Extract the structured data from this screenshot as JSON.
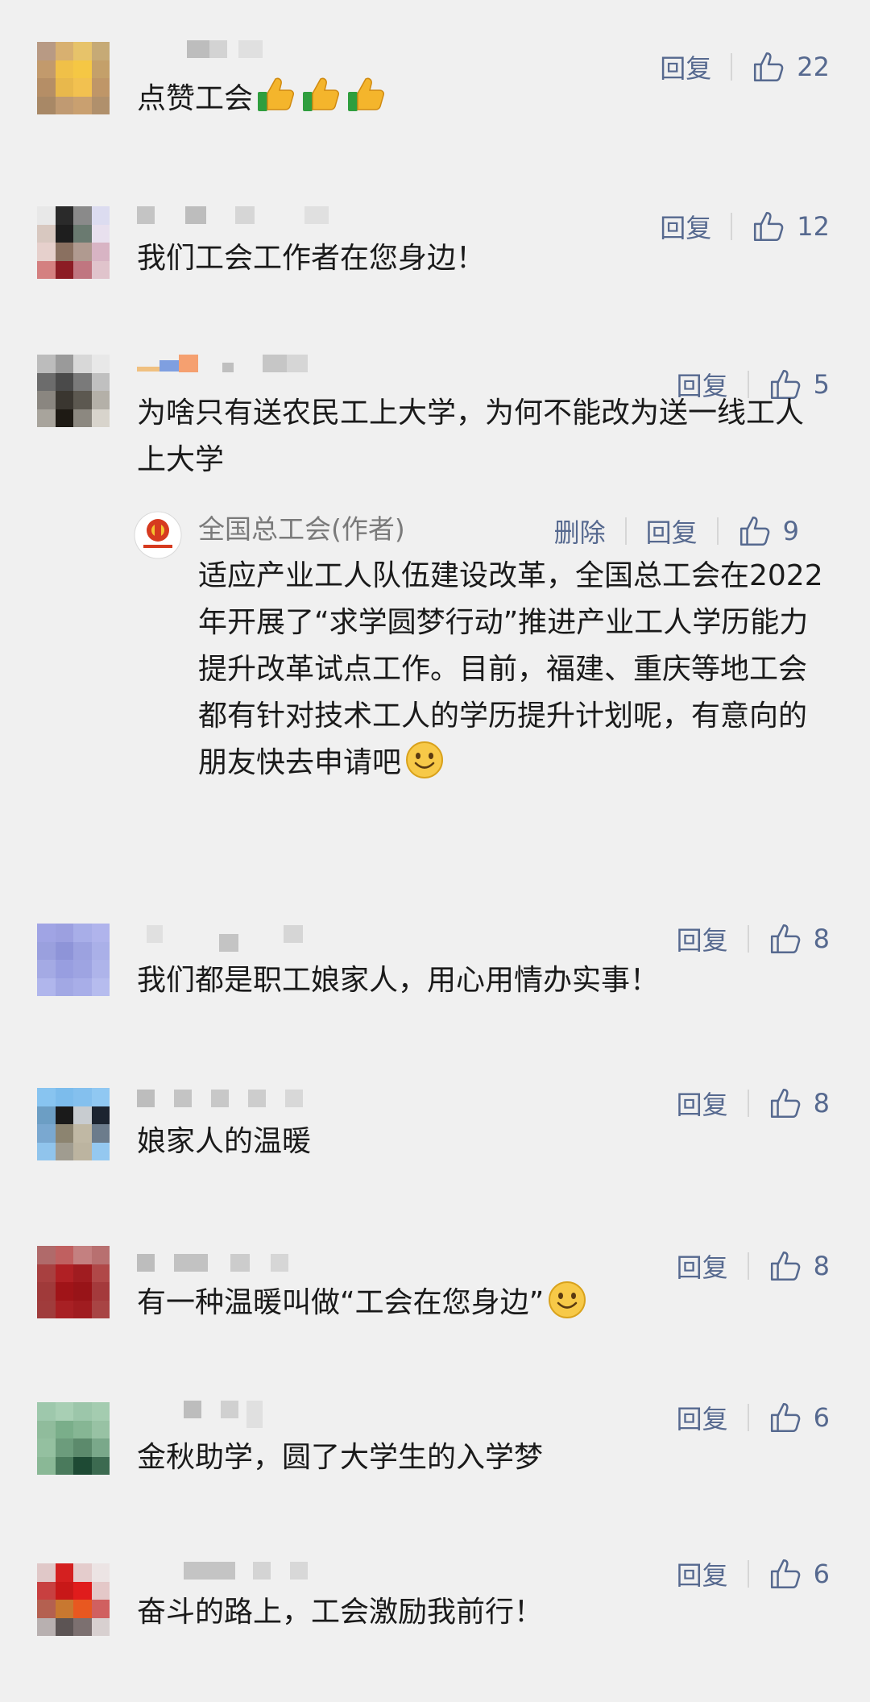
{
  "labels": {
    "reply": "回复",
    "delete": "删除"
  },
  "colors": {
    "link": "#56698f",
    "background": "#f0f0f0"
  },
  "comments": [
    {
      "text": "点赞工会",
      "likes": "22",
      "emojis": "thumbs-up x3"
    },
    {
      "text": "我们工会工作者在您身边！",
      "likes": "12"
    },
    {
      "text": "为啥只有送农民工上大学，为何不能改为送一线工人上大学",
      "likes": "5",
      "author_reply": {
        "author": "全国总工会(作者)",
        "likes": "9",
        "text": "适应产业工人队伍建设改革，全国总工会在2022年开展了“求学圆梦行动”推进产业工人学历能力提升改革试点工作。目前，福建、重庆等地工会都有针对技术工人的学历提升计划呢，有意向的朋友快去申请吧"
      }
    },
    {
      "text": "我们都是职工娘家人，用心用情办实事！",
      "likes": "8"
    },
    {
      "text": "娘家人的温暖",
      "likes": "8"
    },
    {
      "text": "有一种温暖叫做“工会在您身边”",
      "likes": "8"
    },
    {
      "text": "金秋助学，圆了大学生的入学梦",
      "likes": "6"
    },
    {
      "text": "奋斗的路上，工会激励我前行！",
      "likes": "6"
    }
  ]
}
